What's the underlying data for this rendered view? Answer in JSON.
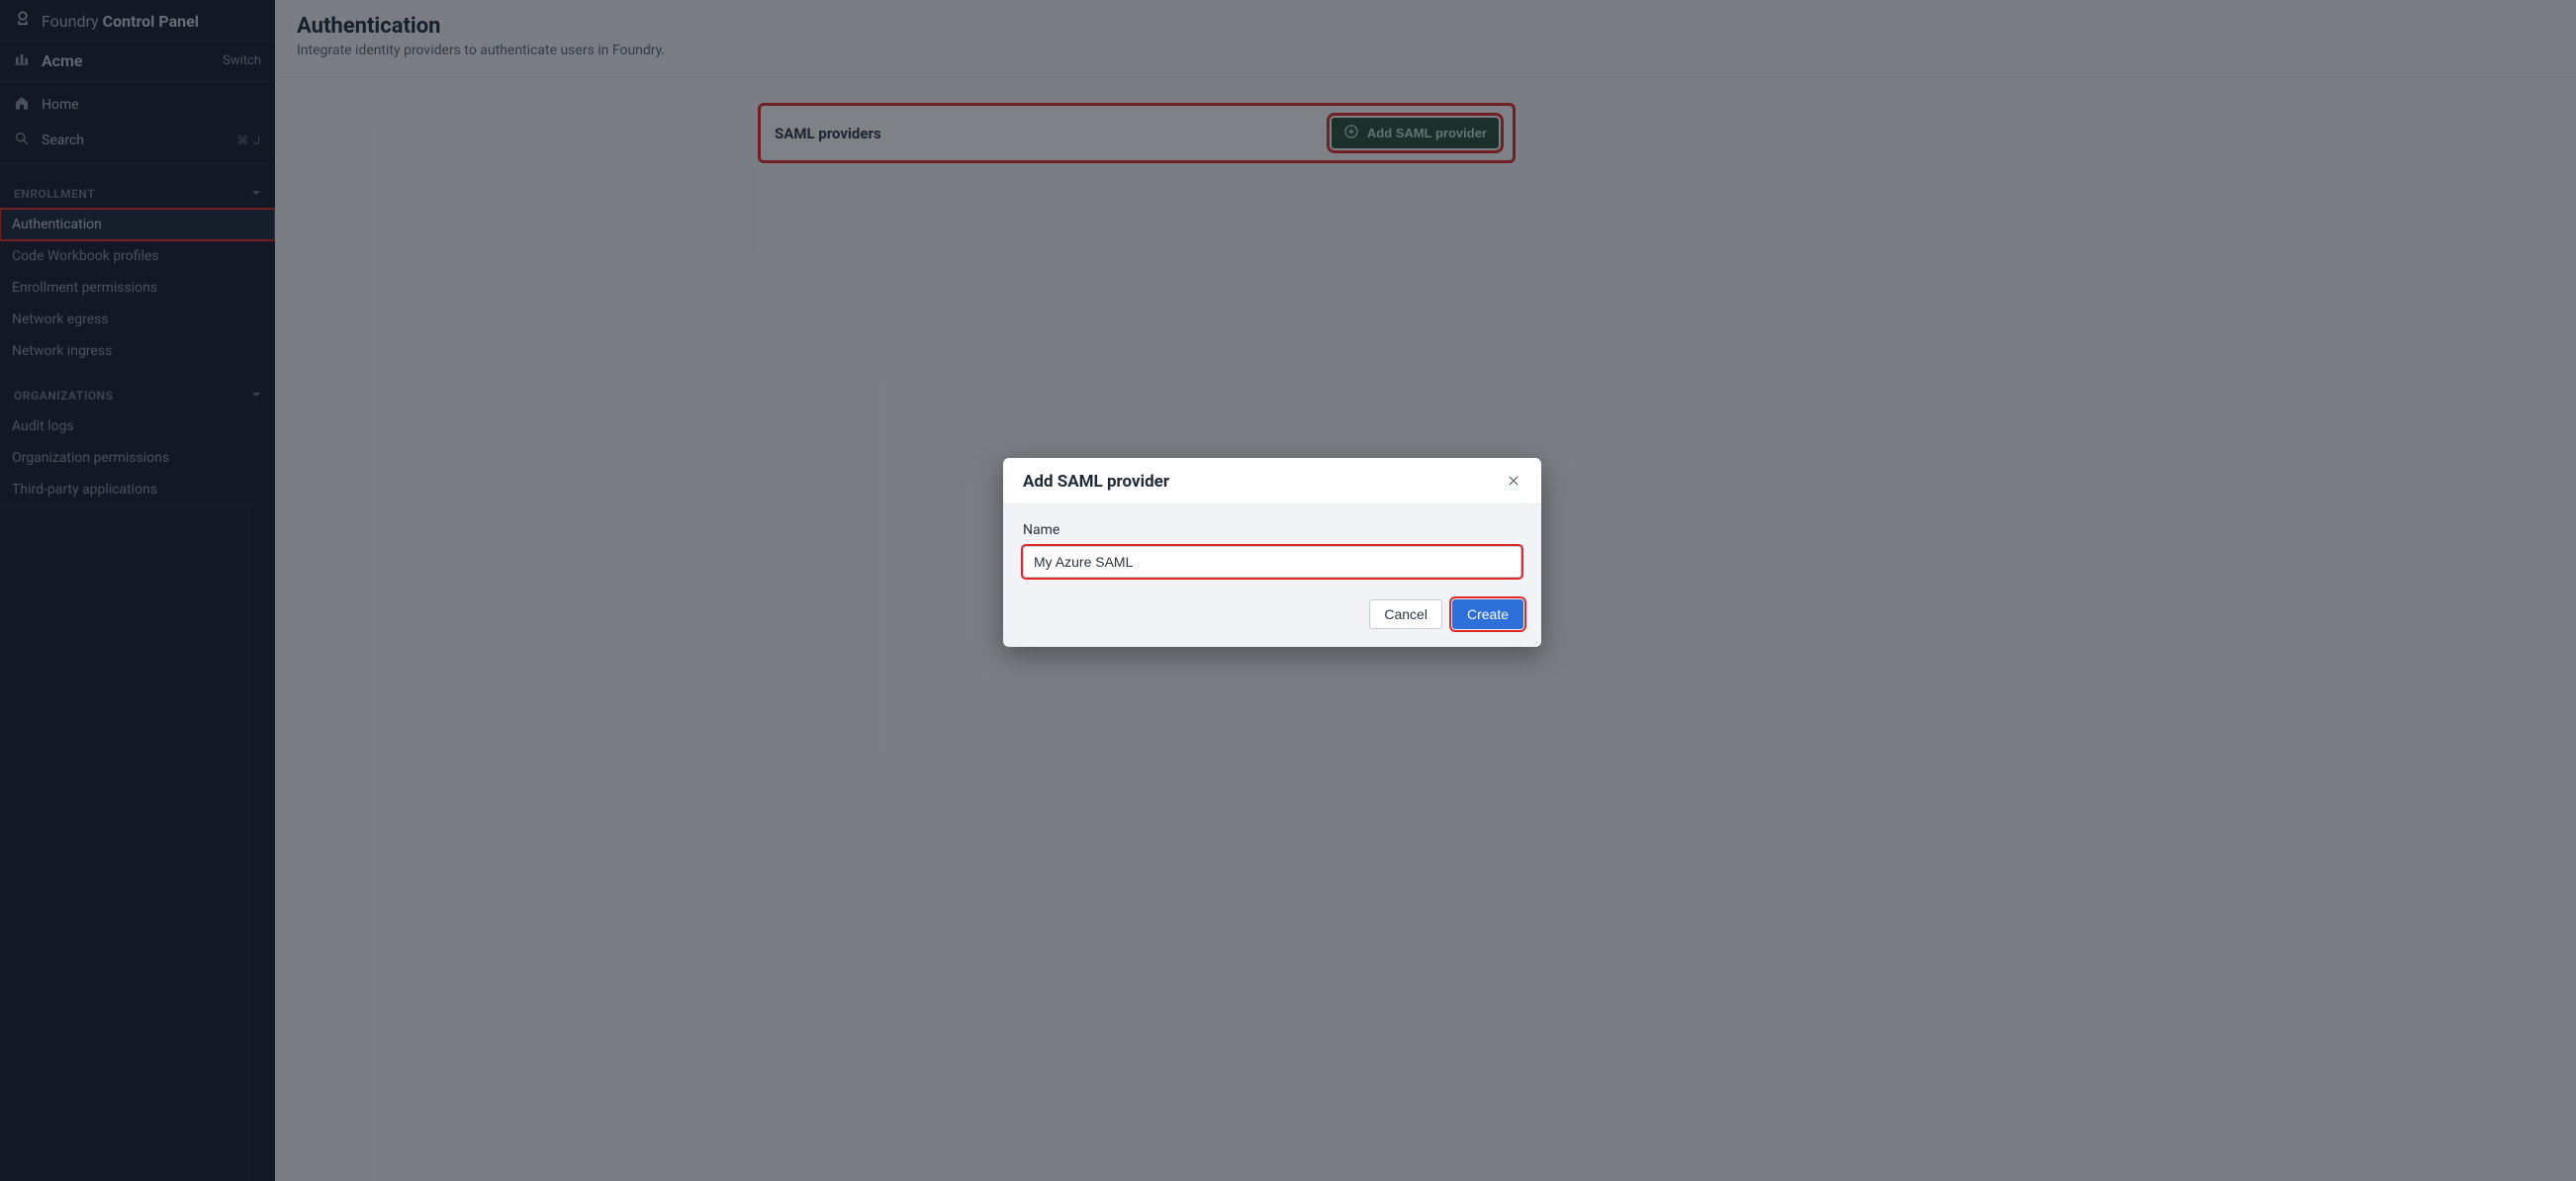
{
  "brand": {
    "prefix": "Foundry",
    "suffix": "Control Panel"
  },
  "org": {
    "name": "Acme",
    "switch": "Switch"
  },
  "nav": {
    "home": "Home",
    "search": "Search",
    "shortcut": "⌘ J"
  },
  "sections": {
    "enrollment": {
      "title": "ENROLLMENT",
      "items": [
        "Authentication",
        "Code Workbook profiles",
        "Enrollment permissions",
        "Network egress",
        "Network ingress"
      ],
      "activeIndex": 0
    },
    "organizations": {
      "title": "ORGANIZATIONS",
      "items": [
        "Audit logs",
        "Organization permissions",
        "Third-party applications"
      ]
    }
  },
  "page": {
    "title": "Authentication",
    "subtitle": "Integrate identity providers to authenticate users in Foundry."
  },
  "saml_card": {
    "title": "SAML providers",
    "add_button": "Add SAML provider"
  },
  "dialog": {
    "title": "Add SAML provider",
    "name_label": "Name",
    "name_value": "My Azure SAML",
    "cancel": "Cancel",
    "create": "Create"
  }
}
